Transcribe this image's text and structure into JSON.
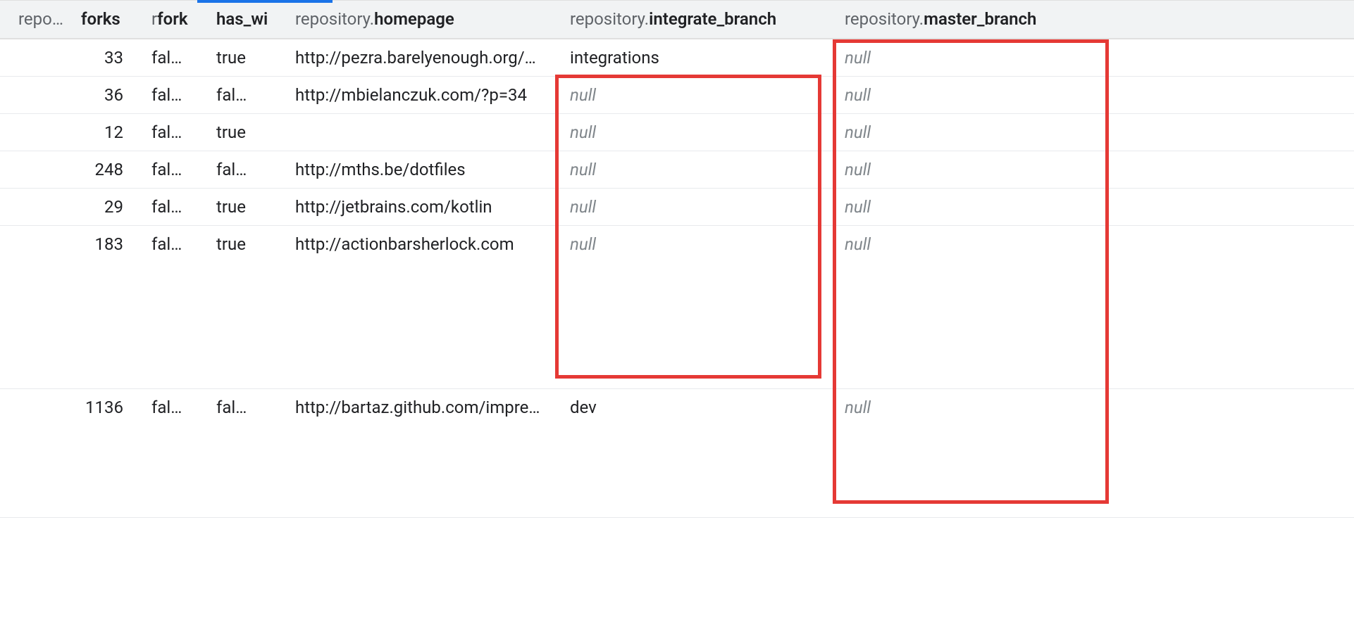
{
  "columns": {
    "c0": {
      "prefix": "reposit…",
      "bold": "forks"
    },
    "c1": {
      "prefix": "r",
      "bold": "fork"
    },
    "c2": {
      "prefix": "",
      "bold": "has_wi"
    },
    "c3": {
      "prefix": "repository.",
      "bold": "homepage"
    },
    "c4": {
      "prefix": "repository.",
      "bold": "integrate_branch"
    },
    "c5": {
      "prefix": "repository.",
      "bold": "master_branch"
    }
  },
  "rows": [
    {
      "forks": "33",
      "rfork": "fal…",
      "haswi": "true",
      "homepage": "http://pezra.barelyenough.org/…",
      "integrate": "integrations",
      "master": null
    },
    {
      "forks": "36",
      "rfork": "fal…",
      "haswi": "fal…",
      "homepage": "http://mbielanczuk.com/?p=34",
      "integrate": null,
      "master": null
    },
    {
      "forks": "12",
      "rfork": "fal…",
      "haswi": "true",
      "homepage": "",
      "integrate": null,
      "master": null
    },
    {
      "forks": "248",
      "rfork": "fal…",
      "haswi": "fal…",
      "homepage": "http://mths.be/dotfiles",
      "integrate": null,
      "master": null
    },
    {
      "forks": "29",
      "rfork": "fal…",
      "haswi": "true",
      "homepage": "http://jetbrains.com/kotlin",
      "integrate": null,
      "master": null
    },
    {
      "forks": "183",
      "rfork": "fal…",
      "haswi": "true",
      "homepage": "http://actionbarsherlock.com",
      "integrate": null,
      "master": null,
      "tall": "tall1"
    },
    {
      "forks": "1136",
      "rfork": "fal…",
      "haswi": "fal…",
      "homepage": "http://bartaz.github.com/impre…",
      "integrate": "dev",
      "master": null,
      "tall": "tall2"
    }
  ],
  "null_label": "null"
}
